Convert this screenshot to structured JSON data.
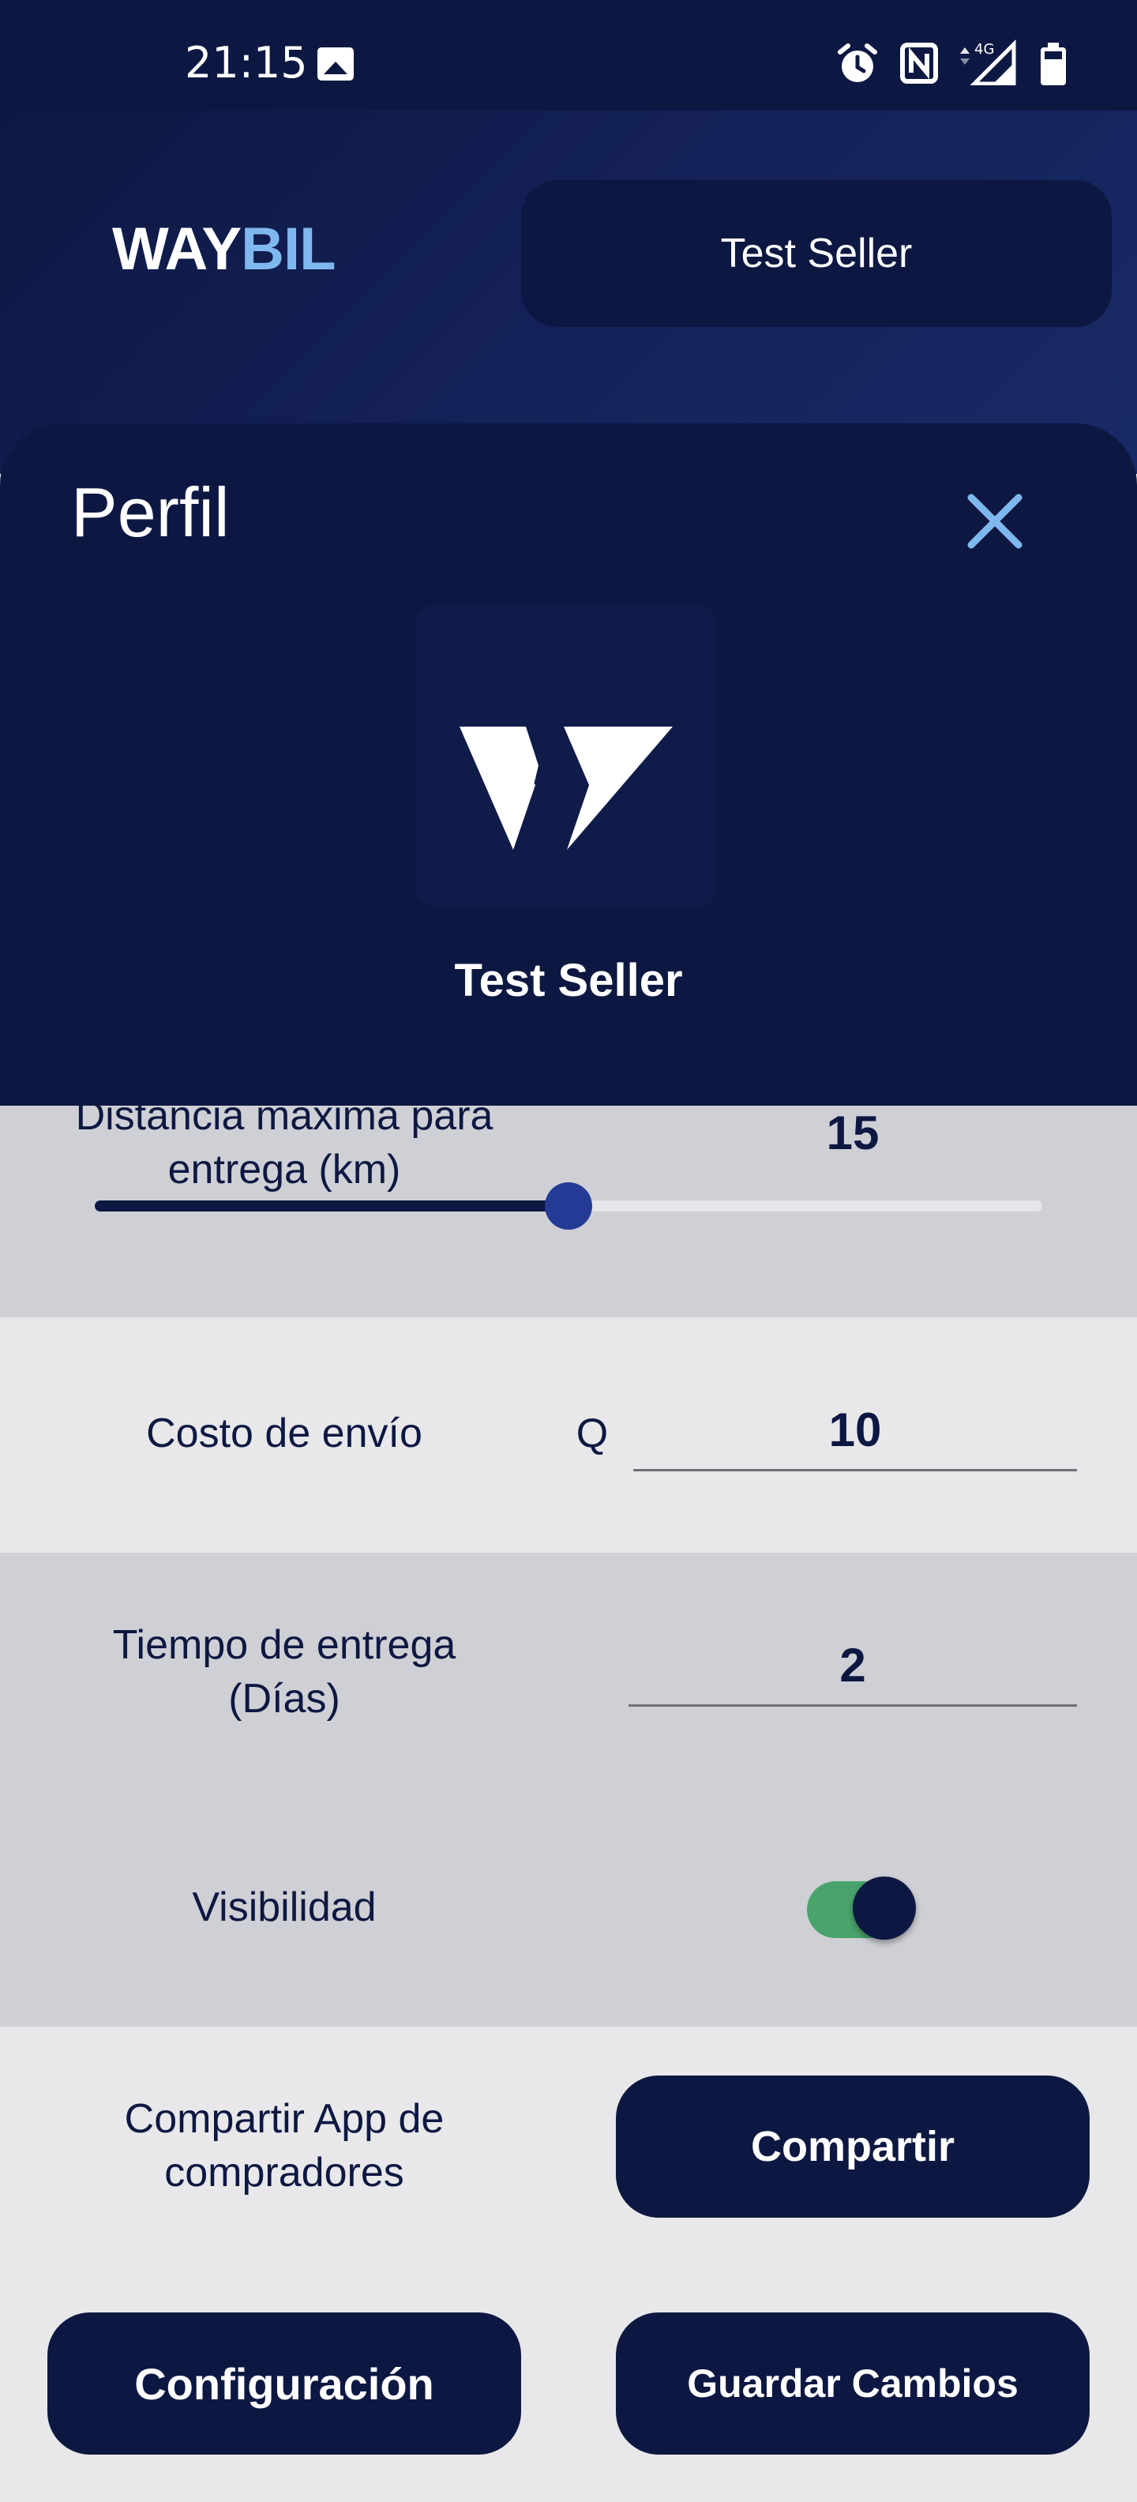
{
  "status_bar": {
    "time": "21:15",
    "icons": [
      "image-icon",
      "alarm-icon",
      "nfc-icon",
      "signal-4g-icon",
      "battery-icon"
    ],
    "network_label": "4G"
  },
  "header": {
    "logo_part1": "WAY",
    "logo_part2": "BIL",
    "seller_button_label": "Test Seller"
  },
  "profile": {
    "title": "Perfil",
    "seller_name": "Test Seller"
  },
  "settings": {
    "max_distance": {
      "label": "Distancia máxima para entrega (km)",
      "value": "15",
      "slider_fraction": 0.5
    },
    "shipping_cost": {
      "label": "Costo de envío",
      "currency": "Q",
      "value": "10"
    },
    "delivery_time": {
      "label": "Tiempo de entrega (Días)",
      "value": "2"
    },
    "visibility": {
      "label": "Visibilidad",
      "enabled": true
    },
    "share": {
      "label": "Compartir App de compradores",
      "button_label": "Compartir"
    }
  },
  "footer": {
    "config_button": "Configuración",
    "save_button": "Guardar Cambios"
  },
  "colors": {
    "navy": "#0d1842",
    "accent_blue": "#7eb8ee",
    "toggle_on": "#49a46c",
    "slider_thumb": "#243a95"
  }
}
